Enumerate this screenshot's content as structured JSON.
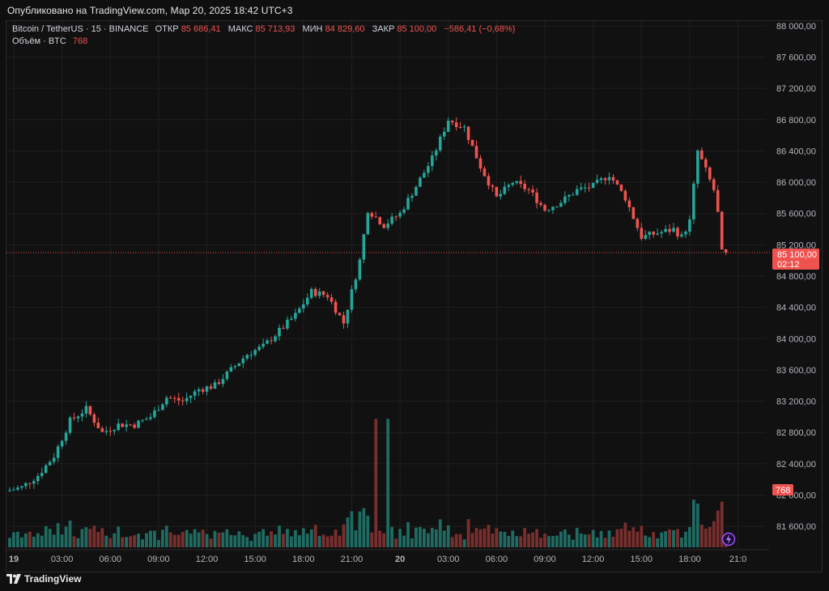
{
  "header": {
    "published": "Опубликовано на TradingView.com, Мар 20, 2025 18:42 UTC+3"
  },
  "legend": {
    "symbol": "Bitcoin / TetherUS · 15 · BINANCE",
    "open_label": "ОТКР",
    "open": "85 686,41",
    "high_label": "МАКС",
    "high": "85 713,93",
    "low_label": "МИН",
    "low": "84 829,60",
    "close_label": "ЗАКР",
    "close": "85 100,00",
    "change": "−586,41 (−0,68%)",
    "volume_label": "Объём · BTC",
    "volume": "768"
  },
  "footer": {
    "brand": "TradingView"
  },
  "colors": {
    "up": "#26a69a",
    "down": "#ef5350",
    "background": "#111111",
    "grid": "#1f1f1f",
    "text": "#d1d4dc"
  },
  "chart_data": {
    "type": "candlestick",
    "y_ticks": [
      "88 000,00",
      "87 600,00",
      "87 200,00",
      "86 800,00",
      "86 400,00",
      "86 000,00",
      "85 600,00",
      "85 200,00",
      "84 800,00",
      "84 400,00",
      "84 000,00",
      "83 600,00",
      "83 200,00",
      "82 800,00",
      "82 400,00",
      "82 000,00",
      "81 600,00"
    ],
    "y_tick_values": [
      88000,
      87600,
      87200,
      86800,
      86400,
      86000,
      85600,
      85200,
      84800,
      84400,
      84000,
      83600,
      83200,
      82800,
      82400,
      82000,
      81600
    ],
    "ylim": [
      81450,
      88080
    ],
    "x_ticks": [
      {
        "label": "19",
        "bold": true,
        "bar": 1
      },
      {
        "label": "03:00",
        "bar": 13
      },
      {
        "label": "06:00",
        "bar": 25
      },
      {
        "label": "09:00",
        "bar": 37
      },
      {
        "label": "12:00",
        "bar": 49
      },
      {
        "label": "15:00",
        "bar": 61
      },
      {
        "label": "18:00",
        "bar": 73
      },
      {
        "label": "21:00",
        "bar": 85
      },
      {
        "label": "20",
        "bold": true,
        "bar": 97
      },
      {
        "label": "03:00",
        "bar": 109
      },
      {
        "label": "06:00",
        "bar": 121
      },
      {
        "label": "09:00",
        "bar": 133
      },
      {
        "label": "12:00",
        "bar": 145
      },
      {
        "label": "15:00",
        "bar": 157
      },
      {
        "label": "18:00",
        "bar": 169
      },
      {
        "label": "21:0",
        "bar": 181
      }
    ],
    "last_price": {
      "value": 85100,
      "label": "85 100,00",
      "countdown": "02:12"
    },
    "last_volume": {
      "label": "768"
    },
    "price_waypoints": [
      [
        0,
        82050
      ],
      [
        4,
        82100
      ],
      [
        8,
        82250
      ],
      [
        12,
        82500
      ],
      [
        16,
        82950
      ],
      [
        20,
        83100
      ],
      [
        24,
        82800
      ],
      [
        28,
        82900
      ],
      [
        32,
        82900
      ],
      [
        36,
        83000
      ],
      [
        40,
        83250
      ],
      [
        44,
        83200
      ],
      [
        48,
        83350
      ],
      [
        52,
        83400
      ],
      [
        56,
        83600
      ],
      [
        60,
        83800
      ],
      [
        64,
        83900
      ],
      [
        68,
        84100
      ],
      [
        72,
        84300
      ],
      [
        76,
        84600
      ],
      [
        80,
        84550
      ],
      [
        84,
        84200
      ],
      [
        88,
        85000
      ],
      [
        90,
        85650
      ],
      [
        94,
        85450
      ],
      [
        98,
        85600
      ],
      [
        102,
        85950
      ],
      [
        106,
        86300
      ],
      [
        110,
        86800
      ],
      [
        114,
        86700
      ],
      [
        118,
        86200
      ],
      [
        122,
        85800
      ],
      [
        126,
        86000
      ],
      [
        130,
        85900
      ],
      [
        134,
        85650
      ],
      [
        138,
        85750
      ],
      [
        142,
        85900
      ],
      [
        146,
        85950
      ],
      [
        150,
        86100
      ],
      [
        154,
        85800
      ],
      [
        158,
        85300
      ],
      [
        162,
        85350
      ],
      [
        166,
        85400
      ],
      [
        168,
        85300
      ],
      [
        170,
        85500
      ],
      [
        172,
        86400
      ],
      [
        176,
        85900
      ],
      [
        177,
        85600
      ],
      [
        178,
        85100
      ]
    ],
    "volume_scale": {
      "max_btc": 2600
    }
  }
}
